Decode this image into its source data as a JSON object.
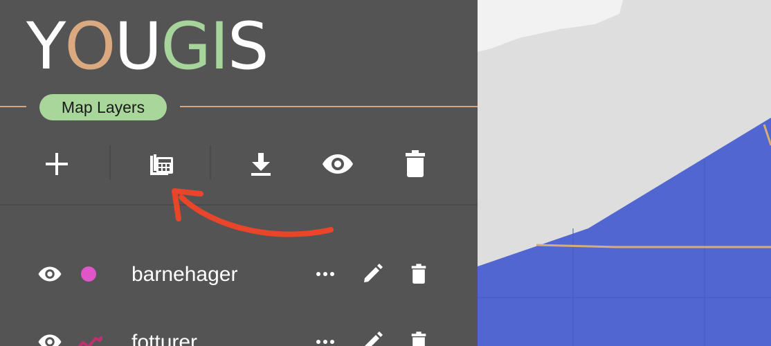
{
  "logo": {
    "letters": [
      "Y",
      "O",
      "U",
      "G",
      "I",
      "S"
    ]
  },
  "panel": {
    "title": "Map Layers"
  },
  "toolbar": [
    {
      "icon": "add-icon",
      "label": "add layer"
    },
    {
      "icon": "calculator-icon",
      "label": "layer calculator"
    },
    {
      "icon": "download-icon",
      "label": "download"
    },
    {
      "icon": "eye-icon",
      "label": "toggle visibility"
    },
    {
      "icon": "trash-icon",
      "label": "delete"
    }
  ],
  "layers": [
    {
      "name": "barnehager",
      "symbol": "point",
      "color": "#e056c8"
    },
    {
      "name": "fotturer",
      "symbol": "line",
      "color": "#c0306f"
    }
  ],
  "colors": {
    "sidebar": "#545454",
    "accent_orange": "#dba97f",
    "accent_green": "#a9d69b",
    "map_land": "#dedede",
    "map_water": "#5266d1",
    "annotation_arrow": "#e8452b"
  }
}
